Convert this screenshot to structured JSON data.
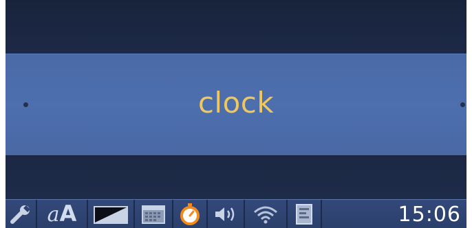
{
  "menu": {
    "current_item_label": "clock"
  },
  "status_bar": {
    "icons": [
      "wrench-icon",
      "font-size-icon",
      "brightness-icon",
      "calendar-icon",
      "timer-icon",
      "volume-icon",
      "wifi-icon",
      "document-icon"
    ],
    "font_size_small": "a",
    "font_size_large": "A",
    "time": "15:06"
  },
  "colors": {
    "menu_band": "#4d6fae",
    "label_text": "#f0c75a",
    "timer_accent": "#f28a1c",
    "background": "#1e2b48"
  }
}
